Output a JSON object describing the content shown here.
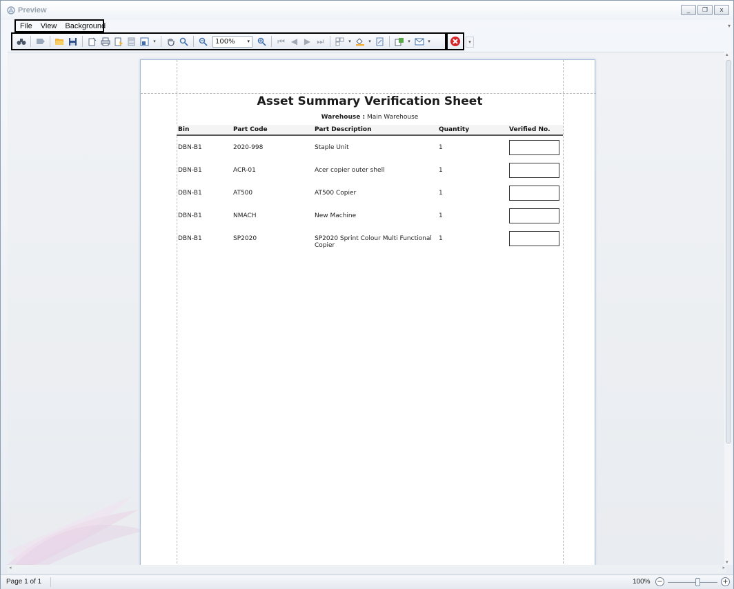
{
  "window": {
    "title": "Preview",
    "controls": {
      "minimize": "_",
      "restore": "❐",
      "close": "x"
    }
  },
  "menu": [
    {
      "label": "File"
    },
    {
      "label": "View"
    },
    {
      "label": "Background"
    }
  ],
  "toolbar": {
    "zoom_value": "100%"
  },
  "report": {
    "title": "Asset Summary Verification Sheet",
    "warehouse_label": "Warehouse :",
    "warehouse_value": "Main Warehouse",
    "columns": [
      "Bin",
      "Part Code",
      "Part Description",
      "Quantity",
      "Verified No."
    ],
    "rows": [
      {
        "bin": "DBN-B1",
        "part_code": "2020-998",
        "description": "Staple Unit",
        "quantity": "1"
      },
      {
        "bin": "DBN-B1",
        "part_code": "ACR-01",
        "description": "Acer copier outer shell",
        "quantity": "1"
      },
      {
        "bin": "DBN-B1",
        "part_code": "AT500",
        "description": "AT500 Copier",
        "quantity": "1"
      },
      {
        "bin": "DBN-B1",
        "part_code": "NMACH",
        "description": "New Machine",
        "quantity": "1"
      },
      {
        "bin": "DBN-B1",
        "part_code": "SP2020",
        "description": "SP2020 Sprint Colour Multi Functional Copier",
        "quantity": "1"
      }
    ]
  },
  "status": {
    "page": "Page 1 of 1",
    "zoom": "100%",
    "zoom_slider_fraction": 0.6
  },
  "colors": {
    "page_border": "#a9bedb",
    "highlight_border": "#000000",
    "close_report_icon": "#d9262b"
  }
}
